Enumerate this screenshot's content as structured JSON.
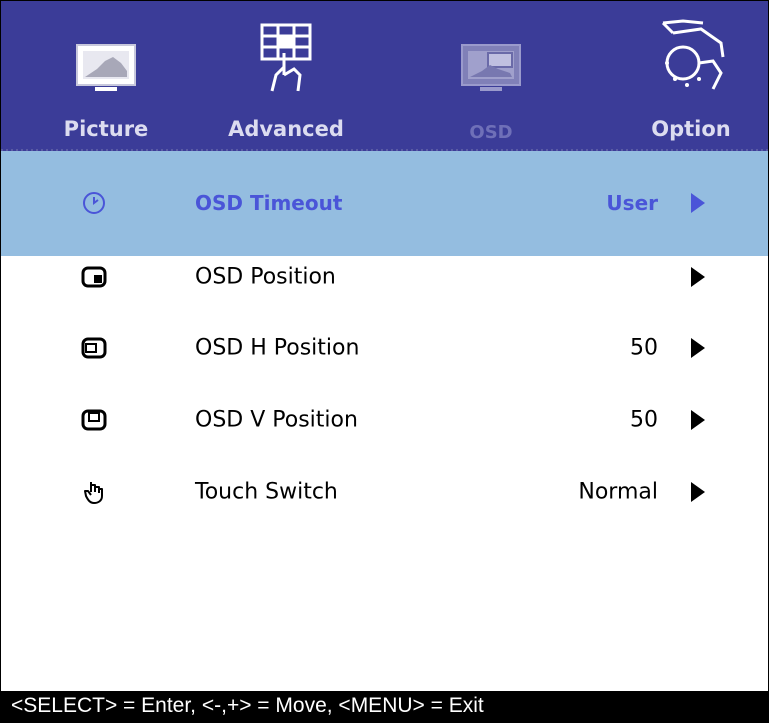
{
  "tabs": [
    {
      "label": "Picture",
      "icon": "picture-icon",
      "active": false
    },
    {
      "label": "Advanced",
      "icon": "advanced-grid-hand-icon",
      "active": false
    },
    {
      "label": "OSD",
      "icon": "osd-icon",
      "active": true
    },
    {
      "label": "Option",
      "icon": "option-touch-icon",
      "active": false
    }
  ],
  "items": [
    {
      "icon": "clock-icon",
      "label": "OSD Timeout",
      "value": "User",
      "selected": true
    },
    {
      "icon": "osd-position-icon",
      "label": "OSD Position",
      "value": "",
      "selected": false
    },
    {
      "icon": "osd-h-position-icon",
      "label": "OSD H Position",
      "value": "50",
      "selected": false
    },
    {
      "icon": "osd-v-position-icon",
      "label": "OSD V Position",
      "value": "50",
      "selected": false
    },
    {
      "icon": "touch-hand-icon",
      "label": "Touch Switch",
      "value": "Normal",
      "selected": false
    }
  ],
  "footer": {
    "hint": "<SELECT> = Enter, <-,+> = Move, <MENU> = Exit"
  },
  "colors": {
    "header_bg": "#3b3c98",
    "selected_bg": "#94bde0",
    "selected_text": "#4a55d8",
    "footer_bg": "#000000"
  }
}
